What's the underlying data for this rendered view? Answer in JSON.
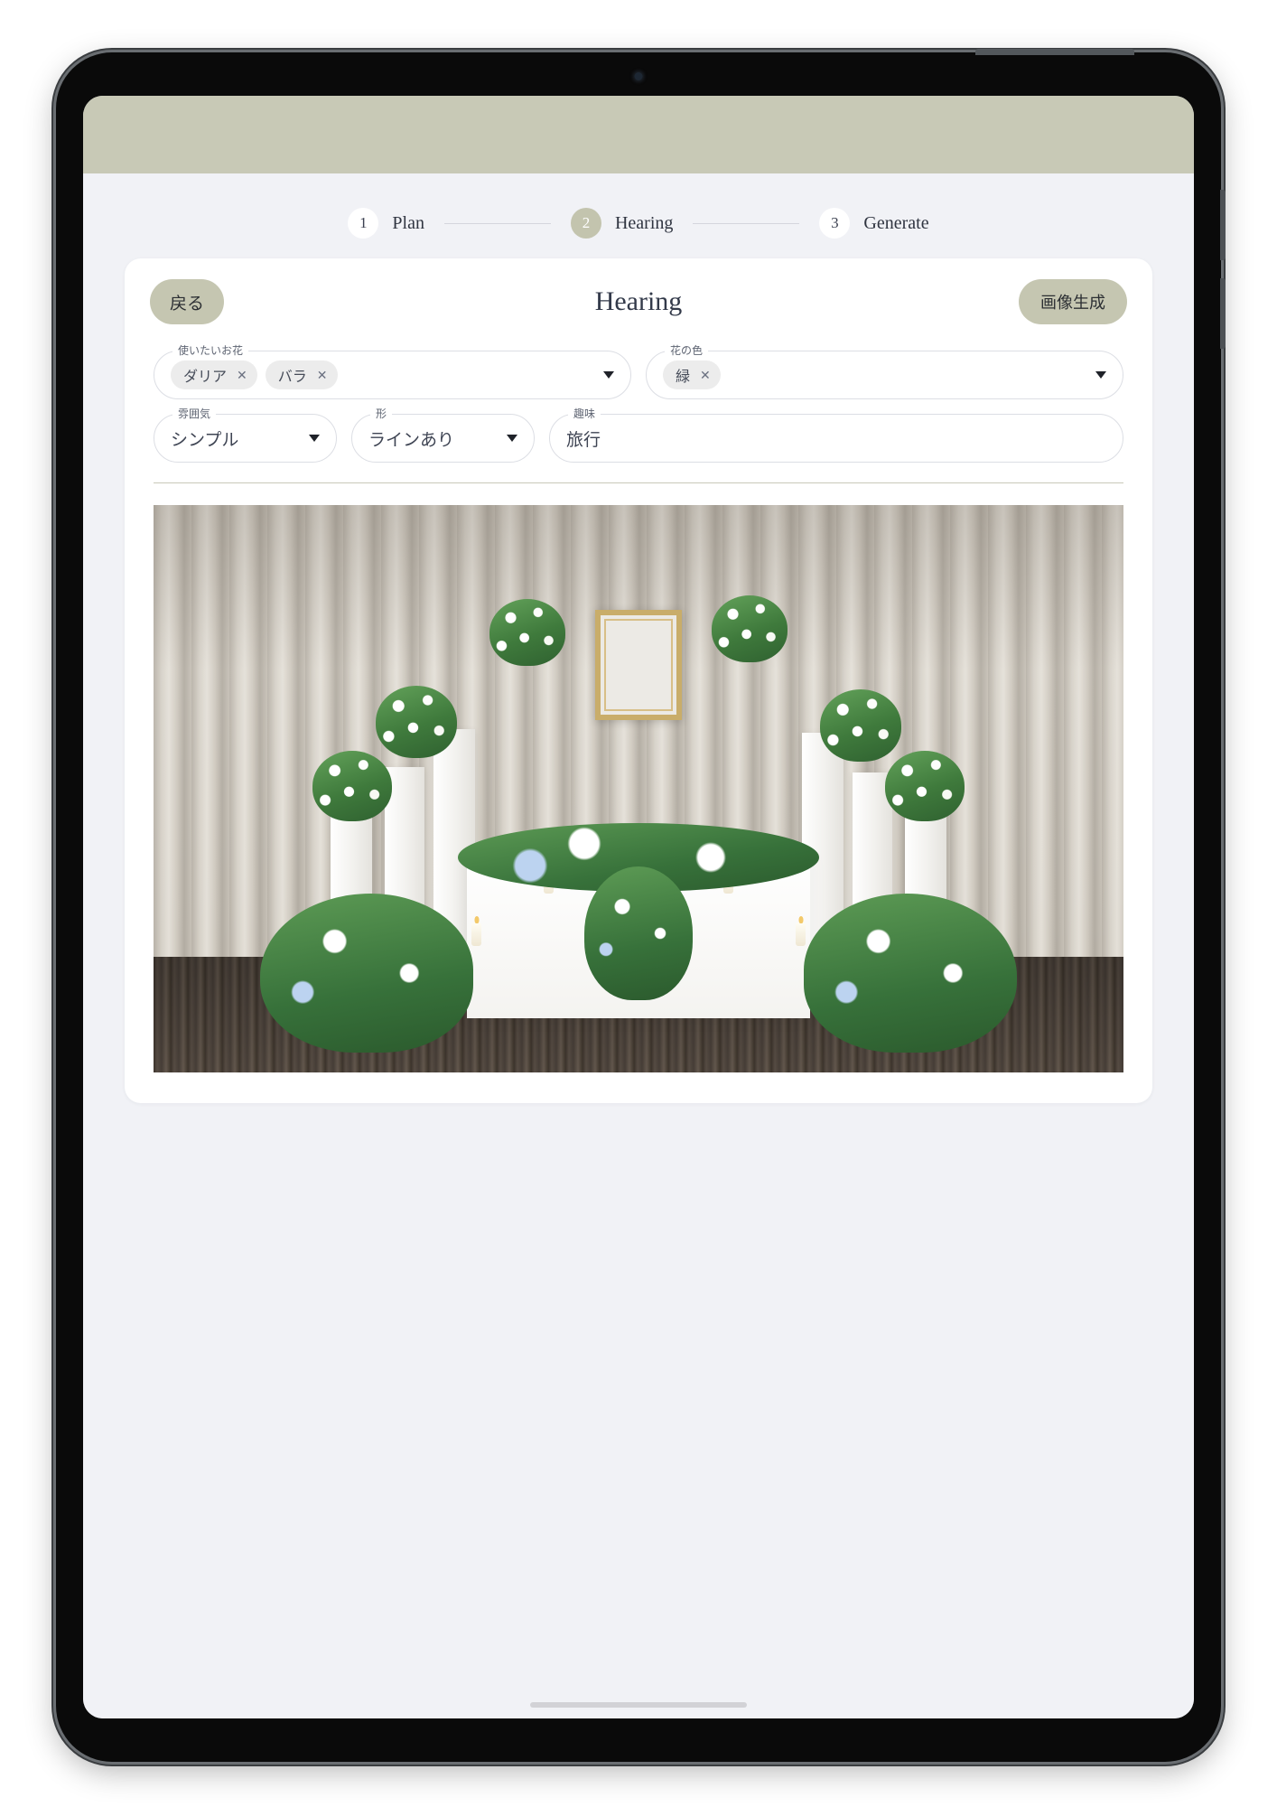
{
  "app": {
    "topbar_color": "#c8c9b6",
    "page_background": "#f1f2f6",
    "accent_color": "#c5c6b1"
  },
  "stepper": {
    "steps": [
      {
        "number": "1",
        "label": "Plan",
        "active": false
      },
      {
        "number": "2",
        "label": "Hearing",
        "active": true
      },
      {
        "number": "3",
        "label": "Generate",
        "active": false
      }
    ]
  },
  "card": {
    "title": "Hearing",
    "back_button": "戻る",
    "generate_button": "画像生成"
  },
  "form": {
    "flowers": {
      "label": "使いたいお花",
      "chips": [
        {
          "label": "ダリア",
          "remove": "✕"
        },
        {
          "label": "バラ",
          "remove": "✕"
        }
      ]
    },
    "flower_color": {
      "label": "花の色",
      "chips": [
        {
          "label": "緑",
          "remove": "✕"
        }
      ]
    },
    "atmosphere": {
      "label": "雰囲気",
      "value": "シンプル"
    },
    "shape": {
      "label": "形",
      "value": "ラインあり"
    },
    "hobby": {
      "label": "趣味",
      "value": "旅行"
    }
  },
  "preview": {
    "alt": "funeral-altar-flower-arrangement-preview"
  }
}
